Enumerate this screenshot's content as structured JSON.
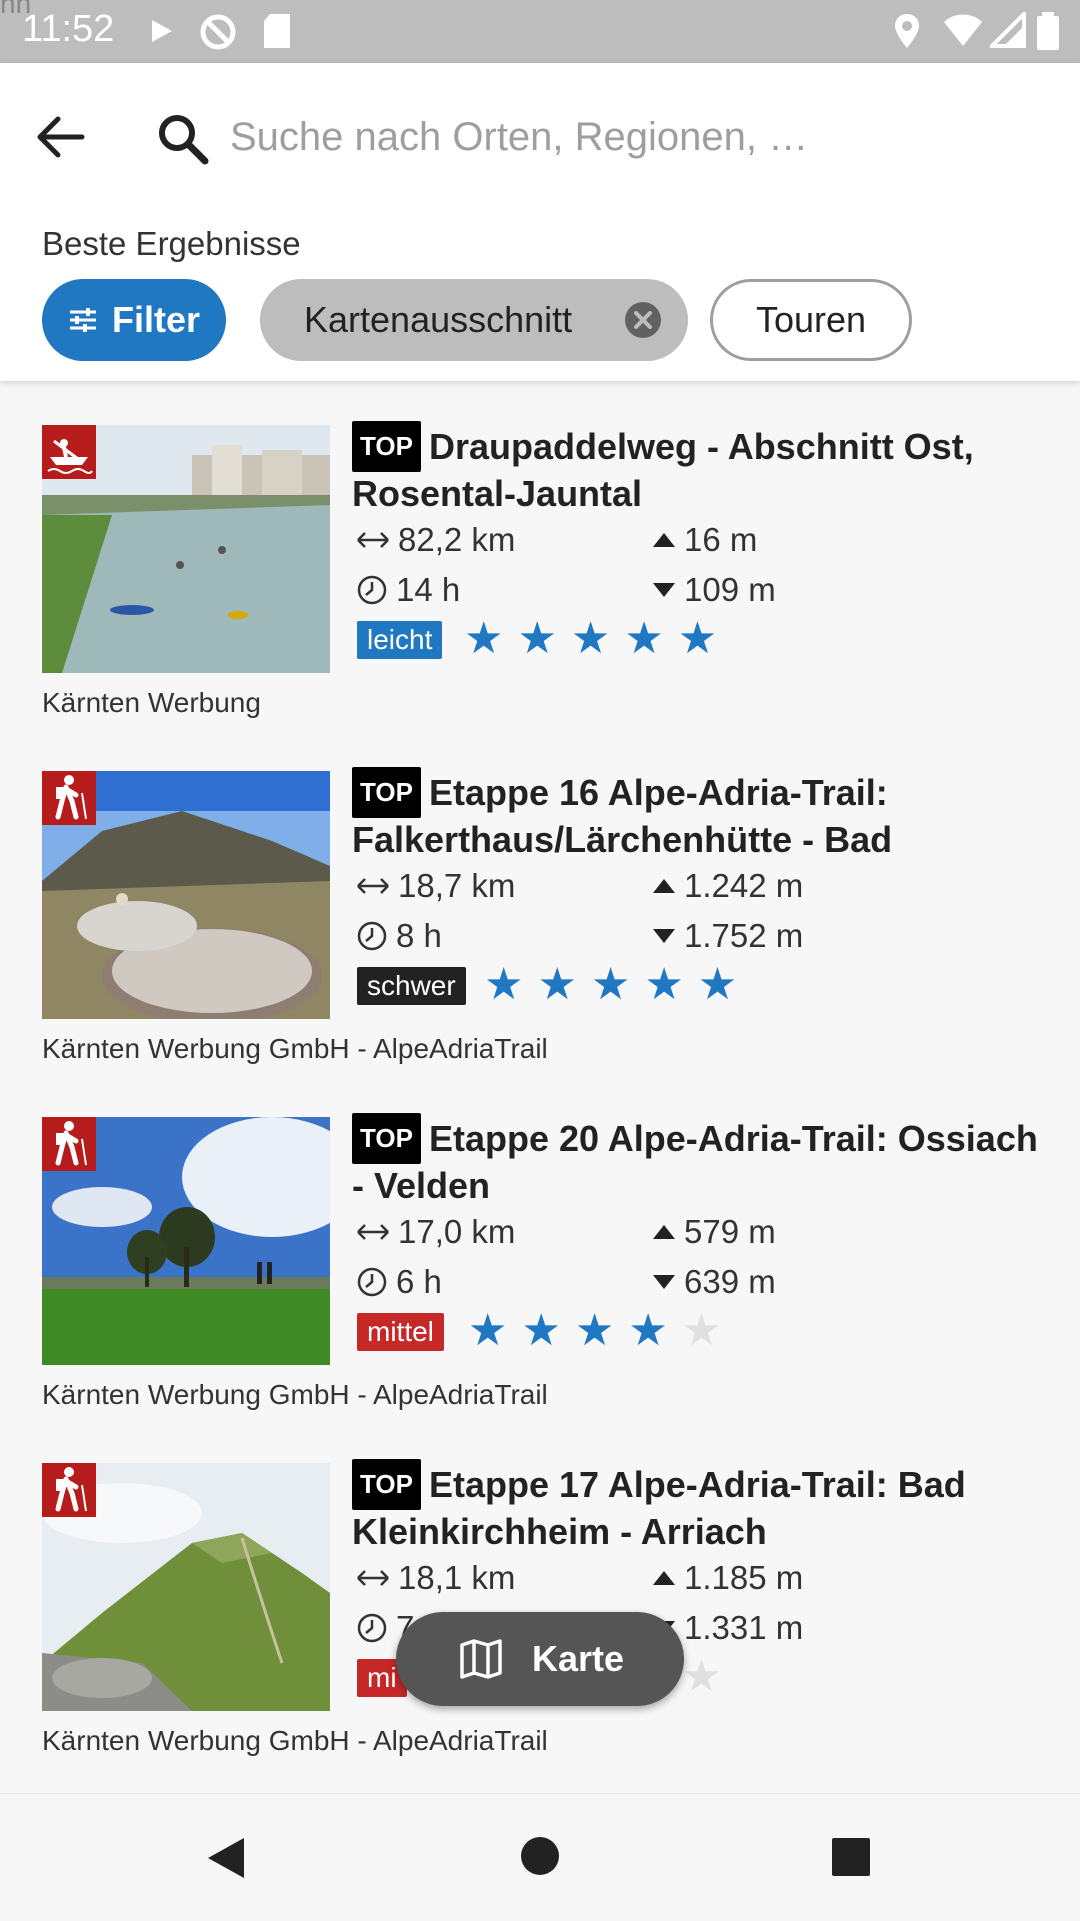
{
  "status_bar": {
    "time": "11:52",
    "corner_text": "nn"
  },
  "header": {
    "search_placeholder": "Suche nach Orten, Regionen, …",
    "section_label": "Beste Ergebnisse",
    "chips": {
      "filter": "Filter",
      "map_section": "Kartenausschnitt",
      "tours": "Touren"
    }
  },
  "results": [
    {
      "badge": "TOP",
      "title": "Draupaddelweg - Abschnitt Ost, Rosental-Jauntal",
      "distance": "82,2 km",
      "duration": "14 h",
      "ascent": "16 m",
      "descent": "109 m",
      "difficulty": "leicht",
      "difficulty_color": "#1f78c1",
      "rating": 5,
      "category_icon": "canoe-icon",
      "credit": "Kärnten Werbung"
    },
    {
      "badge": "TOP",
      "title": "Etappe 16 Alpe-Adria-Trail: Falkerthaus/Lärchenhütte - Bad",
      "distance": "18,7 km",
      "duration": "8 h",
      "ascent": "1.242 m",
      "descent": "1.752 m",
      "difficulty": "schwer",
      "difficulty_color": "#222222",
      "rating": 5,
      "category_icon": "hiker-icon",
      "credit": "Kärnten Werbung GmbH - AlpeAdriaTrail"
    },
    {
      "badge": "TOP",
      "title": "Etappe 20 Alpe-Adria-Trail: Ossiach - Velden",
      "distance": "17,0 km",
      "duration": "6 h",
      "ascent": "579 m",
      "descent": "639 m",
      "difficulty": "mittel",
      "difficulty_color": "#c62828",
      "rating": 4,
      "category_icon": "hiker-icon",
      "credit": "Kärnten Werbung GmbH - AlpeAdriaTrail"
    },
    {
      "badge": "TOP",
      "title": "Etappe 17 Alpe-Adria-Trail: Bad Kleinkirchheim - Arriach",
      "distance": "18,1 km",
      "duration": "7",
      "ascent": "1.185 m",
      "descent": "1.331 m",
      "difficulty": "mi",
      "difficulty_color": "#c62828",
      "rating": 4,
      "category_icon": "hiker-icon",
      "credit": "Kärnten Werbung GmbH - AlpeAdriaTrail"
    }
  ],
  "fab": {
    "label": "Karte"
  },
  "colors": {
    "accent": "#1f78c1",
    "category": "#b71c1c"
  }
}
